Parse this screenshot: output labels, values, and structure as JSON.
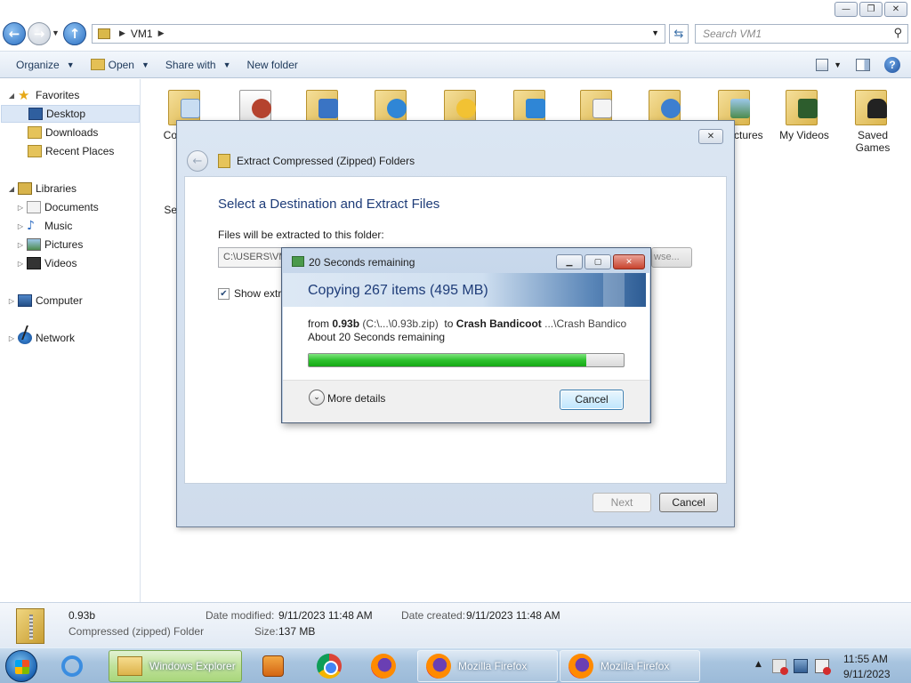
{
  "window": {
    "minimize": "—",
    "maximize": "❐",
    "close": "✕"
  },
  "address": {
    "crumb": "VM1",
    "search_placeholder": "Search VM1"
  },
  "toolbar": {
    "organize": "Organize",
    "open": "Open",
    "share_with": "Share with",
    "new_folder": "New folder"
  },
  "nav": {
    "favorites": "Favorites",
    "desktop": "Desktop",
    "downloads": "Downloads",
    "recent_places": "Recent Places",
    "libraries": "Libraries",
    "documents": "Documents",
    "music": "Music",
    "pictures": "Pictures",
    "videos": "Videos",
    "computer": "Computer",
    "network": "Network"
  },
  "content": {
    "partial_label_1": "Co",
    "partial_label_2": "Se",
    "partial_pictures": "ctures",
    "my_videos": "My Videos",
    "saved_games": "Saved Games"
  },
  "wizard": {
    "title": "Extract Compressed (Zipped) Folders",
    "heading": "Select a Destination and Extract Files",
    "files_label": "Files will be extracted to this folder:",
    "path": "C:\\USERS\\VM",
    "browse": "wse...",
    "show_label": "Show extra",
    "next": "Next",
    "cancel": "Cancel"
  },
  "copy": {
    "title": "20 Seconds remaining",
    "heading": "Copying 267 items (495 MB)",
    "from_word": "from",
    "from_name": "0.93b",
    "from_path": "(C:\\...\\0.93b.zip)",
    "to_word": "to",
    "to_name": "Crash Bandicoot",
    "to_path": "...\\Crash Bandico",
    "remaining": "About 20 Seconds remaining",
    "progress": 0.88,
    "more_details": "More details",
    "cancel": "Cancel"
  },
  "details": {
    "name": "0.93b",
    "type": "Compressed (zipped) Folder",
    "modified_label": "Date modified:",
    "modified_value": "9/11/2023 11:48 AM",
    "created_label": "Date created:",
    "created_value": "9/11/2023 11:48 AM",
    "size_label": "Size:",
    "size_value": "137 MB"
  },
  "taskbar": {
    "explorer": "Windows Explorer",
    "firefox1": "Mozilla Firefox",
    "firefox2": "Mozilla Firefox",
    "time": "11:55 AM",
    "date": "9/11/2023"
  },
  "colors": {
    "accent": "#1e3c78",
    "progress_green": "#2ec22e"
  }
}
